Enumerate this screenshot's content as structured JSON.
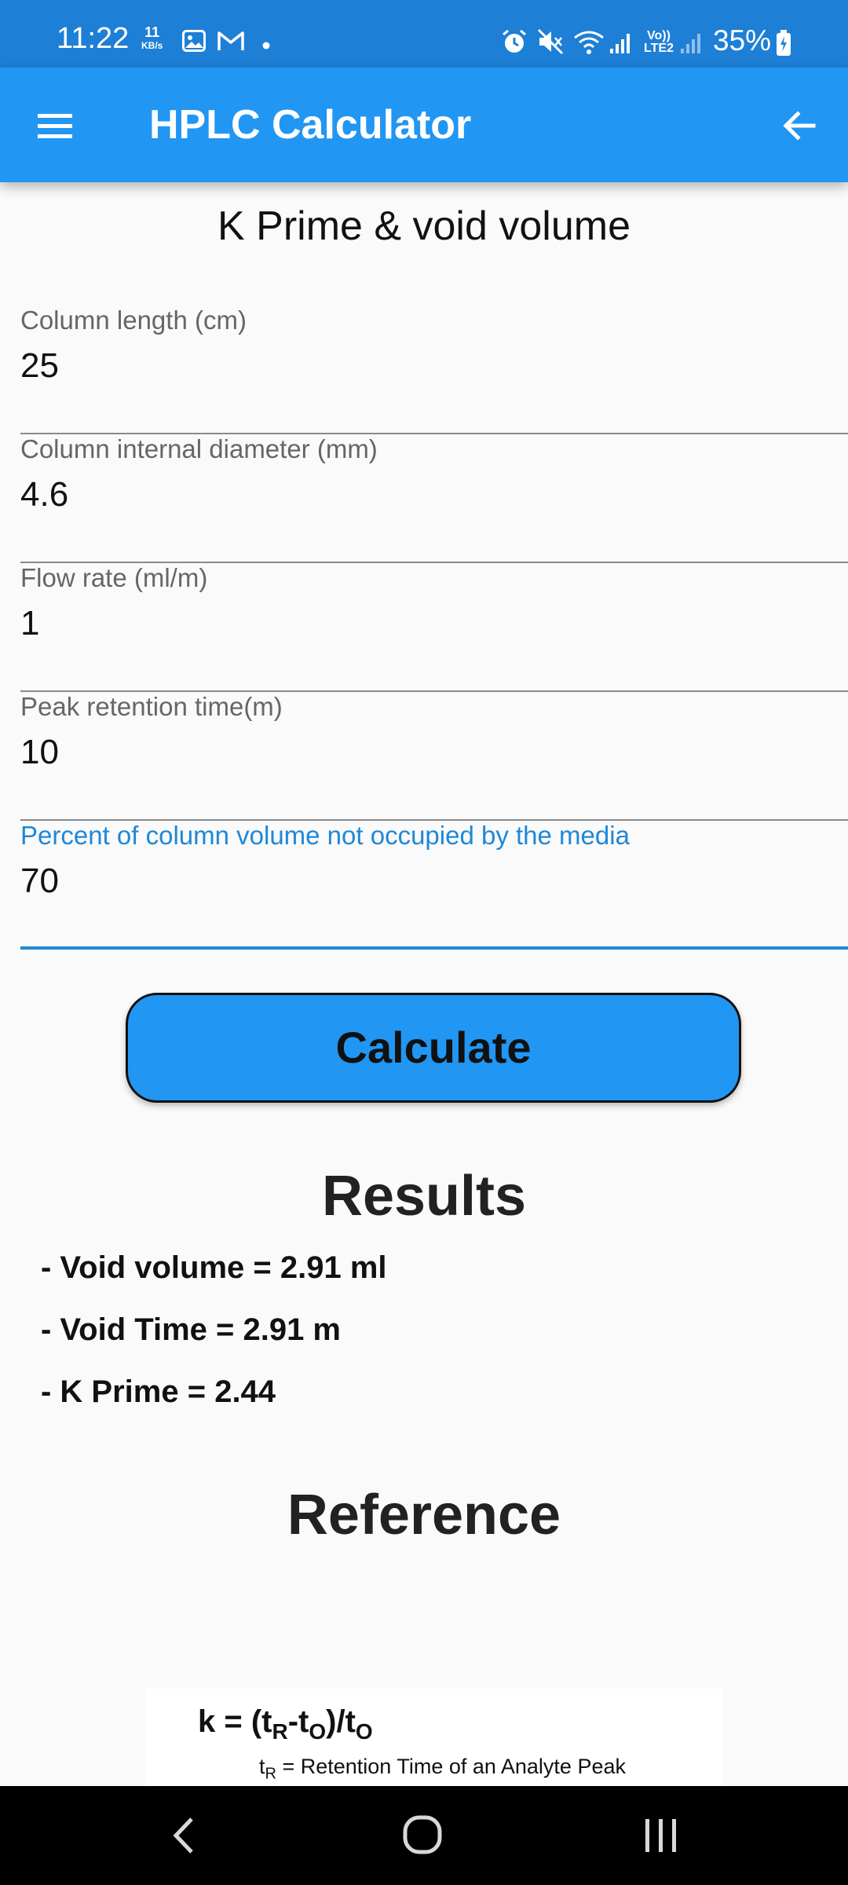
{
  "status_bar": {
    "time": "11:22",
    "speed_value": "11",
    "speed_unit": "KB/s",
    "network_label": "Vo)) LTE2",
    "battery": "35%",
    "icons": [
      "gallery-icon",
      "gmail-icon",
      "dot-icon",
      "alarm-icon",
      "mute-icon",
      "wifi-icon",
      "signal-icon",
      "signal-icon-2",
      "battery-icon"
    ]
  },
  "app_bar": {
    "title": "HPLC Calculator",
    "menu_icon": "hamburger-menu-icon",
    "back_icon": "arrow-back-icon"
  },
  "page": {
    "heading": "K Prime & void volume"
  },
  "fields": [
    {
      "label": "Column length (cm)",
      "value": "25"
    },
    {
      "label": "Column internal diameter (mm)",
      "value": "4.6"
    },
    {
      "label": "Flow rate (ml/m)",
      "value": "1"
    },
    {
      "label": "Peak retention time(m)",
      "value": "10"
    },
    {
      "label": "Percent of column volume not occupied by the media",
      "value": "70"
    }
  ],
  "calculate_button": {
    "label": "Calculate"
  },
  "results": {
    "heading": "Results",
    "lines": [
      "- Void volume = 2.91 ml",
      "- Void Time = 2.91 m",
      "- K Prime = 2.44"
    ]
  },
  "reference": {
    "heading": "Reference",
    "formula_k": "k = (t",
    "formula_r": "R",
    "formula_mid": "-t",
    "formula_o": "O",
    "formula_end": ")/t",
    "formula_o2": "O",
    "legend_t": "t",
    "legend_r": "R",
    "legend_text": " = Retention Time of an Analyte Peak"
  },
  "nav_bar": {
    "icons": [
      "nav-back-icon",
      "nav-home-icon",
      "nav-recents-icon"
    ]
  },
  "colors": {
    "status_bar": "#1e7fd6",
    "app_bar": "#2196f3",
    "accent": "#1e88d8",
    "button": "#2196f3"
  }
}
